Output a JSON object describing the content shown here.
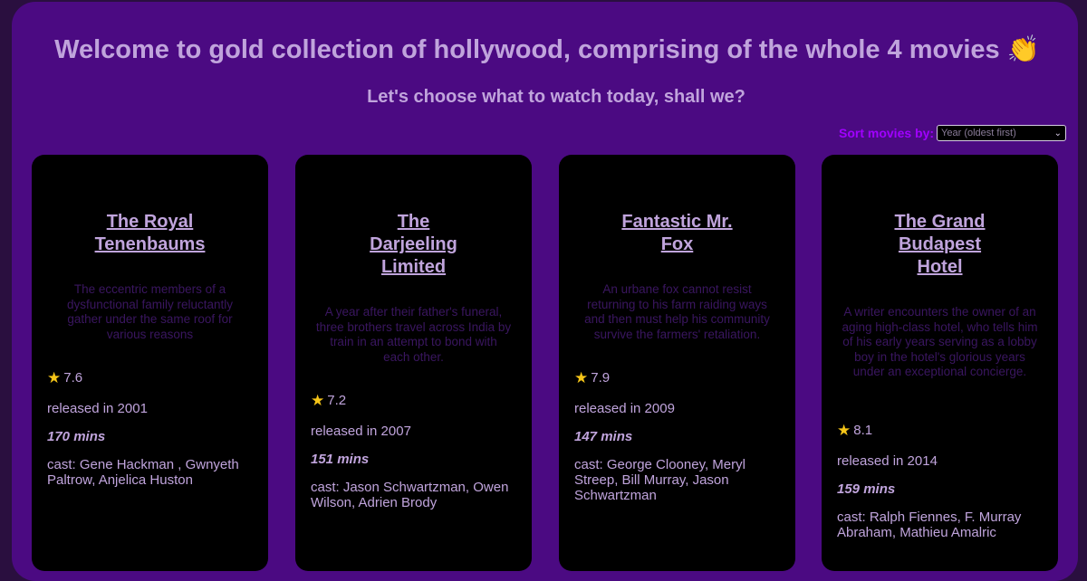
{
  "header": {
    "title": "Welcome to gold collection of hollywood, comprising of the whole 4 movies 👏",
    "subtitle": "Let's choose what to watch today, shall we?"
  },
  "sort": {
    "label": "Sort movies by:",
    "selected": "Year (oldest first)"
  },
  "movies": [
    {
      "title_lines": [
        "The Royal",
        "Tenenbaums"
      ],
      "description": "The eccentric members of a dysfunctional family reluctantly gather under the same roof for various reasons",
      "rating": "7.6",
      "released": "released in 2001",
      "runtime": "170 mins",
      "cast": "cast: Gene Hackman , Gwnyeth Paltrow, Anjelica Huston"
    },
    {
      "title_lines": [
        "The",
        "Darjeeling",
        "Limited"
      ],
      "description": "A year after their father's funeral, three brothers travel across India by train in an attempt to bond with each other.",
      "rating": "7.2",
      "released": "released in 2007",
      "runtime": "151 mins",
      "cast": "cast: Jason Schwartzman, Owen Wilson, Adrien Brody"
    },
    {
      "title_lines": [
        "Fantastic Mr.",
        "Fox"
      ],
      "description": "An urbane fox cannot resist returning to his farm raiding ways and then must help his community survive the farmers' retaliation.",
      "rating": "7.9",
      "released": "released in 2009",
      "runtime": "147 mins",
      "cast": "cast: George Clooney, Meryl Streep, Bill Murray, Jason Schwartzman"
    },
    {
      "title_lines": [
        "The Grand",
        "Budapest",
        "Hotel"
      ],
      "description": "A writer encounters the owner of an aging high-class hotel, who tells him of his early years serving as a lobby boy in the hotel's glorious years under an exceptional concierge.",
      "rating": "8.1",
      "released": "released in 2014",
      "runtime": "159 mins",
      "cast": "cast: Ralph Fiennes, F. Murray Abraham, Mathieu Amalric"
    }
  ],
  "icons": {
    "star": "star-icon",
    "caret": "chevron-down-icon"
  },
  "colors": {
    "background": "#4b0a82",
    "card": "#000000",
    "text": "#c0a4dc",
    "sort_label": "#a100ff"
  }
}
